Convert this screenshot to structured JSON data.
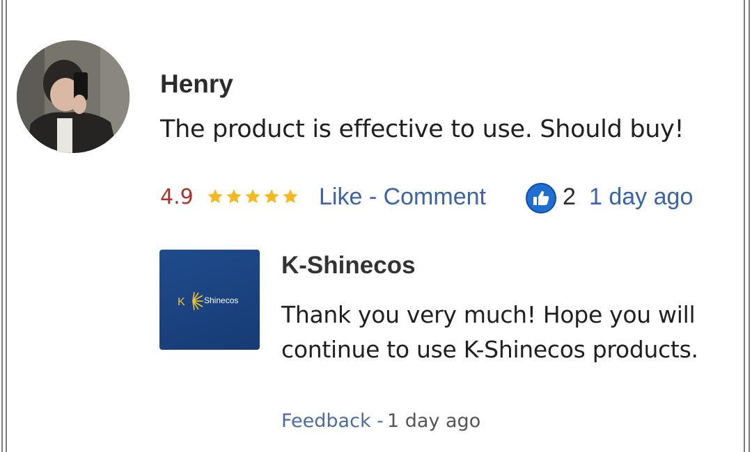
{
  "review": {
    "author": "Henry",
    "text": "The product is effective to use. Should buy!",
    "rating": "4.9",
    "stars": 5,
    "actions": "Like - Comment",
    "like_count": "2",
    "time": "1 day ago"
  },
  "reply": {
    "brand_name": "K-Shinecos",
    "logo_text": "Shinecos",
    "text": "Thank you very much! Hope you will continue to use K-Shinecos products.",
    "feedback_label": "Feedback -",
    "time": "1 day ago"
  },
  "colors": {
    "link": "#3a63a8",
    "rating": "#a8342b",
    "star": "#f6b820",
    "brand_bg": "#1f4b8c",
    "like_icon": "#1f6fd1"
  },
  "icons": {
    "like": "thumbs-up-icon",
    "star": "star-icon",
    "brand_logo": "k-shinecos-logo"
  }
}
